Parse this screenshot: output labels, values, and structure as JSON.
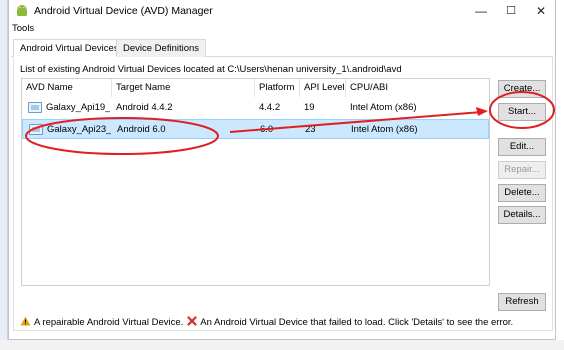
{
  "window": {
    "title": "Android Virtual Device (AVD) Manager",
    "controls": {
      "minimize": "—",
      "maximize": "☐",
      "close": "✕"
    }
  },
  "menu": {
    "tools": "Tools"
  },
  "tabs": [
    {
      "label": "Android Virtual Devices",
      "active": true
    },
    {
      "label": "Device Definitions",
      "active": false
    }
  ],
  "list_caption": "List of existing Android Virtual Devices located at C:\\Users\\henan university_1\\.android\\avd",
  "table": {
    "columns": [
      "AVD Name",
      "Target Name",
      "Platform",
      "API Level",
      "CPU/ABI"
    ],
    "rows": [
      {
        "avd_name": "Galaxy_Api19_...",
        "target_name": "Android 4.4.2",
        "platform": "4.4.2",
        "api_level": "19",
        "cpu_abi": "Intel Atom (x86)",
        "selected": false
      },
      {
        "avd_name": "Galaxy_Api23_...",
        "target_name": "Android 6.0",
        "platform": "6.0",
        "api_level": "23",
        "cpu_abi": "Intel Atom (x86)",
        "selected": true
      }
    ]
  },
  "buttons": {
    "create": "Create...",
    "start": "Start...",
    "edit": "Edit...",
    "repair": "Repair...",
    "delete": "Delete...",
    "details": "Details...",
    "refresh": "Refresh"
  },
  "status": {
    "repairable": "A repairable Android Virtual Device.",
    "failed": "An Android Virtual Device that failed to load. Click 'Details' to see the error."
  },
  "colors": {
    "selection": "#cce8ff",
    "annotation": "#e02020",
    "warning": "#e5a50a",
    "error": "#d42b2b"
  }
}
